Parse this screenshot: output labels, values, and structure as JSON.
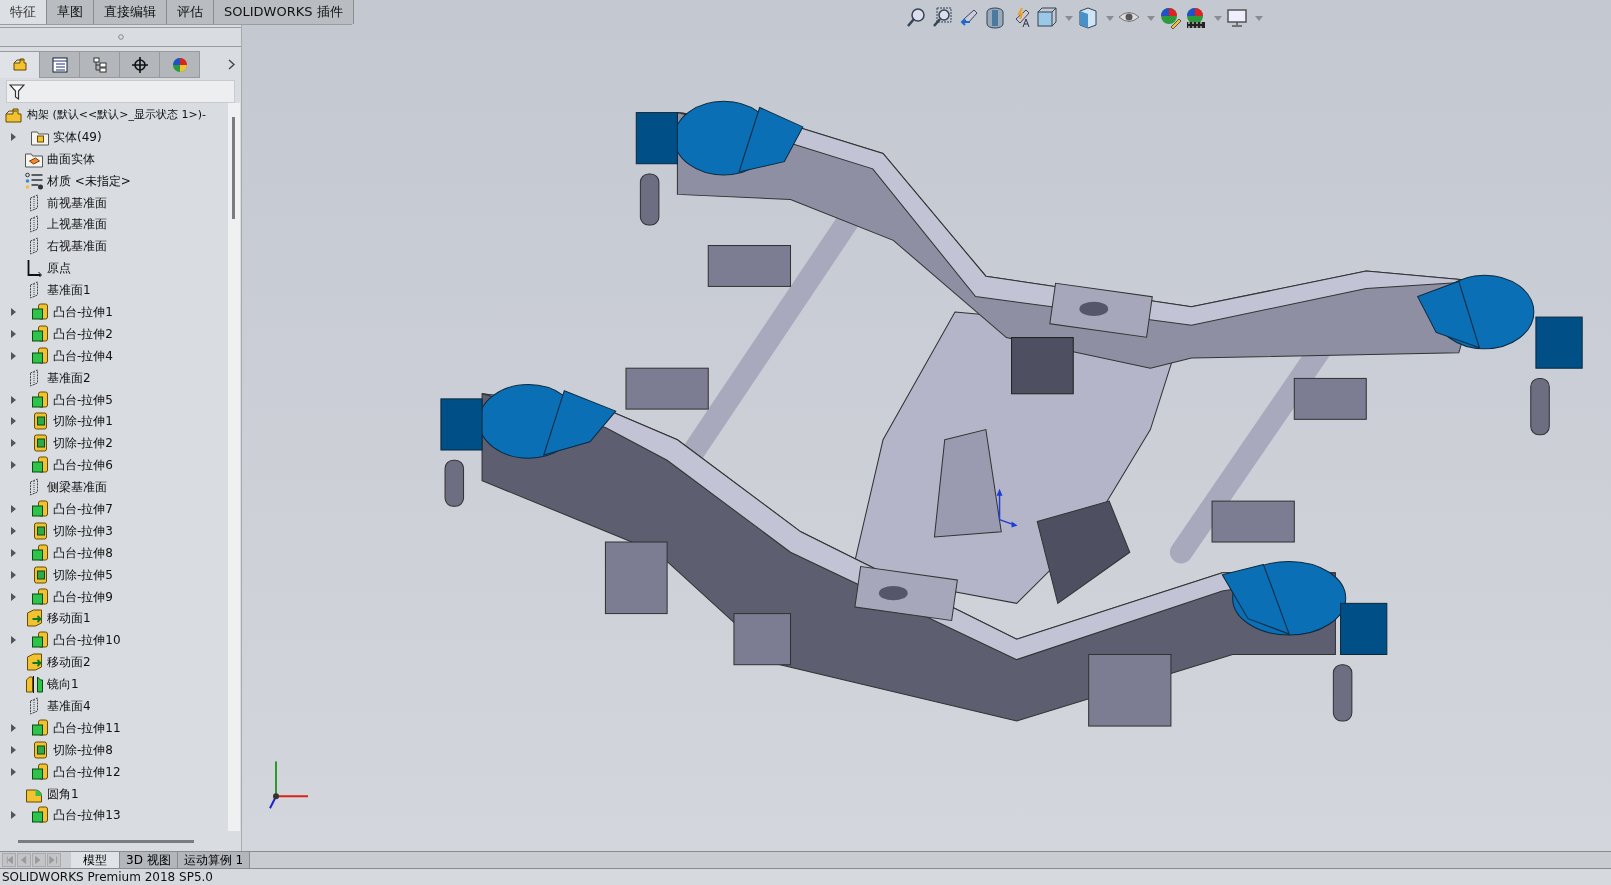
{
  "command_tabs": [
    {
      "label": "特征",
      "selected": true
    },
    {
      "label": "草图",
      "selected": false
    },
    {
      "label": "直接编辑",
      "selected": false
    },
    {
      "label": "评估",
      "selected": false
    },
    {
      "label": "SOLIDWORKS 插件",
      "selected": false
    }
  ],
  "panel_tabs": [
    {
      "kind": "feature",
      "selected": true
    },
    {
      "kind": "property",
      "selected": false
    },
    {
      "kind": "config",
      "selected": false
    },
    {
      "kind": "dimxpert",
      "selected": false
    },
    {
      "kind": "display",
      "selected": false
    }
  ],
  "tree": {
    "root": "构架  (默认<<默认>_显示状态 1>)-",
    "items": [
      {
        "label": "实体(49)",
        "kind": "folder",
        "expandable": true
      },
      {
        "label": "曲面实体",
        "kind": "surface-folder",
        "expandable": false
      },
      {
        "label": "材质 <未指定>",
        "kind": "material",
        "expandable": false
      },
      {
        "label": "前视基准面",
        "kind": "plane",
        "expandable": false
      },
      {
        "label": "上视基准面",
        "kind": "plane",
        "expandable": false
      },
      {
        "label": "右视基准面",
        "kind": "plane",
        "expandable": false
      },
      {
        "label": "原点",
        "kind": "origin",
        "expandable": false
      },
      {
        "label": "基准面1",
        "kind": "plane",
        "expandable": false
      },
      {
        "label": "凸台-拉伸1",
        "kind": "boss",
        "expandable": true
      },
      {
        "label": "凸台-拉伸2",
        "kind": "boss",
        "expandable": true
      },
      {
        "label": "凸台-拉伸4",
        "kind": "boss",
        "expandable": true
      },
      {
        "label": "基准面2",
        "kind": "plane",
        "expandable": false
      },
      {
        "label": "凸台-拉伸5",
        "kind": "boss",
        "expandable": true
      },
      {
        "label": "切除-拉伸1",
        "kind": "cut",
        "expandable": true
      },
      {
        "label": "切除-拉伸2",
        "kind": "cut",
        "expandable": true
      },
      {
        "label": "凸台-拉伸6",
        "kind": "boss",
        "expandable": true
      },
      {
        "label": "侧梁基准面",
        "kind": "plane",
        "expandable": false
      },
      {
        "label": "凸台-拉伸7",
        "kind": "boss",
        "expandable": true
      },
      {
        "label": "切除-拉伸3",
        "kind": "cut",
        "expandable": true
      },
      {
        "label": "凸台-拉伸8",
        "kind": "boss",
        "expandable": true
      },
      {
        "label": "切除-拉伸5",
        "kind": "cut",
        "expandable": true
      },
      {
        "label": "凸台-拉伸9",
        "kind": "boss",
        "expandable": true
      },
      {
        "label": "移动面1",
        "kind": "move-face",
        "expandable": false
      },
      {
        "label": "凸台-拉伸10",
        "kind": "boss",
        "expandable": true
      },
      {
        "label": "移动面2",
        "kind": "move-face",
        "expandable": false
      },
      {
        "label": "镜向1",
        "kind": "mirror",
        "expandable": false
      },
      {
        "label": "基准面4",
        "kind": "plane",
        "expandable": false
      },
      {
        "label": "凸台-拉伸11",
        "kind": "boss",
        "expandable": true
      },
      {
        "label": "切除-拉伸8",
        "kind": "cut",
        "expandable": true
      },
      {
        "label": "凸台-拉伸12",
        "kind": "boss",
        "expandable": true
      },
      {
        "label": "圆角1",
        "kind": "fillet",
        "expandable": false
      },
      {
        "label": "凸台-拉伸13",
        "kind": "boss",
        "expandable": true
      }
    ]
  },
  "bottom_tabs": [
    {
      "label": "模型",
      "selected": true
    },
    {
      "label": "3D 视图",
      "selected": false
    },
    {
      "label": "运动算例 1",
      "selected": false
    }
  ],
  "status_bar": "SOLIDWORKS Premium 2018 SP5.0"
}
